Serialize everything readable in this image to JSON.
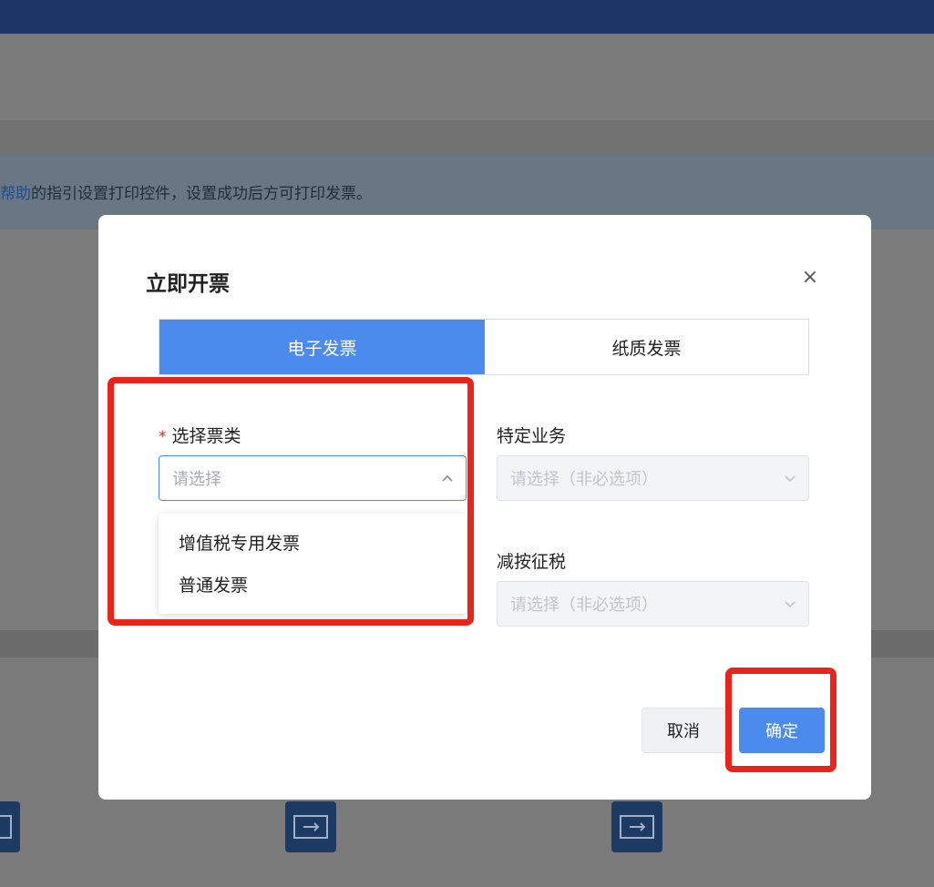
{
  "background": {
    "notice_link": "帮助",
    "notice_text": "的指引设置打印控件，设置成功后方可打印发票。"
  },
  "dialog": {
    "title": "立即开票",
    "close_glyph": "×",
    "tabs": [
      {
        "label": "电子发票",
        "active": true
      },
      {
        "label": "纸质发票",
        "active": false
      }
    ],
    "fields": {
      "ticket_type": {
        "required_mark": "*",
        "label": "选择票类",
        "placeholder": "请选择",
        "expanded": true,
        "options": [
          "增值税专用发票",
          "普通发票"
        ]
      },
      "specific_business": {
        "label": "特定业务",
        "placeholder": "请选择（非必选项）",
        "disabled": true
      },
      "reduced_tax": {
        "label": "减按征税",
        "placeholder": "请选择（非必选项）",
        "disabled": true
      }
    },
    "buttons": {
      "cancel": "取消",
      "confirm": "确定"
    }
  },
  "colors": {
    "primary": "#4a8bed",
    "highlight": "#e8241c",
    "topbar": "#1d3866"
  }
}
